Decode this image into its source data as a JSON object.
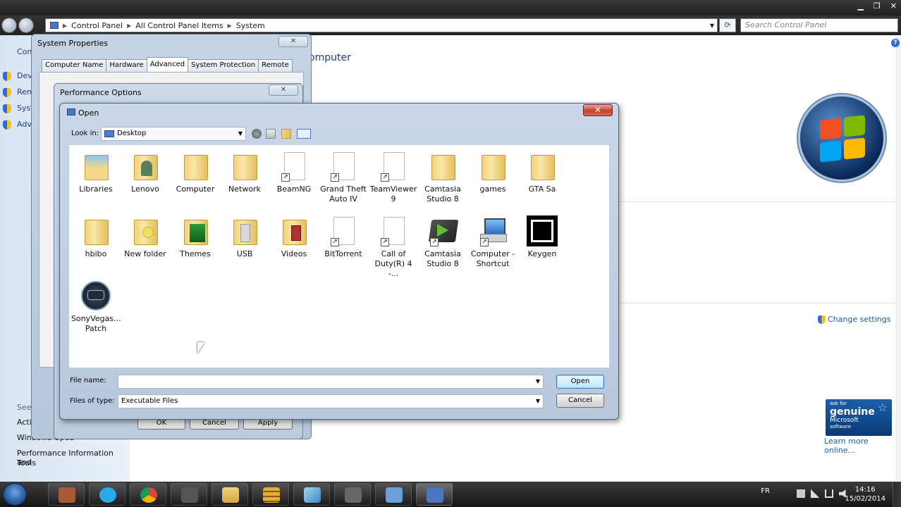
{
  "explorer": {
    "breadcrumb": [
      "Control Panel",
      "All Control Panel Items",
      "System"
    ],
    "search_placeholder": "Search Control Panel",
    "title_fragment": "omputer"
  },
  "left_nav": {
    "top_link": "Cont",
    "items": [
      "Devi",
      "Rem",
      "Syst",
      "Adv"
    ],
    "see_also": "See also",
    "see_also_items": [
      "Action Cen",
      "Windows Upda",
      "Performance Information and",
      "Tools"
    ]
  },
  "right_panel": {
    "change_settings": "Change settings",
    "genuine_lines": [
      "ask for",
      "genuine",
      "Microsoft",
      "software"
    ],
    "learn_more": "Learn more online..."
  },
  "system_properties": {
    "title": "System Properties",
    "tabs": [
      {
        "label": "Computer Name",
        "active": false
      },
      {
        "label": "Hardware",
        "active": false
      },
      {
        "label": "Advanced",
        "active": true
      },
      {
        "label": "System Protection",
        "active": false
      },
      {
        "label": "Remote",
        "active": false
      }
    ]
  },
  "performance_options": {
    "title": "Performance Options",
    "ok": "OK",
    "cancel": "Cancel",
    "apply": "Apply"
  },
  "open_dialog": {
    "title": "Open",
    "close_glyph": "✕",
    "look_in_label": "Look in:",
    "look_in_value": "Desktop",
    "file_name_label": "File name:",
    "file_name_value": "",
    "files_of_type_label": "Files of type:",
    "files_of_type_value": "Executable Files",
    "open_button": "Open",
    "cancel_button": "Cancel",
    "files": [
      {
        "name": "Libraries",
        "icon": "libraries-icon"
      },
      {
        "name": "Lenovo",
        "icon": "user-folder-icon"
      },
      {
        "name": "Computer",
        "icon": "folder-icon"
      },
      {
        "name": "Network",
        "icon": "folder-icon"
      },
      {
        "name": "BeamNG",
        "icon": "shortcut-icon"
      },
      {
        "name": "Grand Theft Auto IV",
        "icon": "shortcut-icon"
      },
      {
        "name": "TeamViewer 9",
        "icon": "shortcut-icon"
      },
      {
        "name": "Camtasia Studio 8",
        "icon": "folder-icon"
      },
      {
        "name": "games",
        "icon": "folder-icon"
      },
      {
        "name": "GTA Sa",
        "icon": "folder-icon"
      },
      {
        "name": "hbibo",
        "icon": "folder-icon"
      },
      {
        "name": "New folder",
        "icon": "folder-icon"
      },
      {
        "name": "Themes",
        "icon": "folder-icon"
      },
      {
        "name": "USB",
        "icon": "folder-icon"
      },
      {
        "name": "Videos",
        "icon": "folder-icon"
      },
      {
        "name": "BitTorrent",
        "icon": "shortcut-icon"
      },
      {
        "name": "Call of Duty(R) 4 -...",
        "icon": "shortcut-icon"
      },
      {
        "name": "Camtasia Studio 8",
        "icon": "camtasia-icon"
      },
      {
        "name": "Computer - Shortcut",
        "icon": "computer-icon"
      },
      {
        "name": "Keygen",
        "icon": "keygen-icon"
      },
      {
        "name": "SonyVegas... Patch",
        "icon": "sony-vegas-icon"
      }
    ]
  },
  "taskbar": {
    "language": "FR",
    "time": "14:16",
    "date": "15/02/2014"
  }
}
